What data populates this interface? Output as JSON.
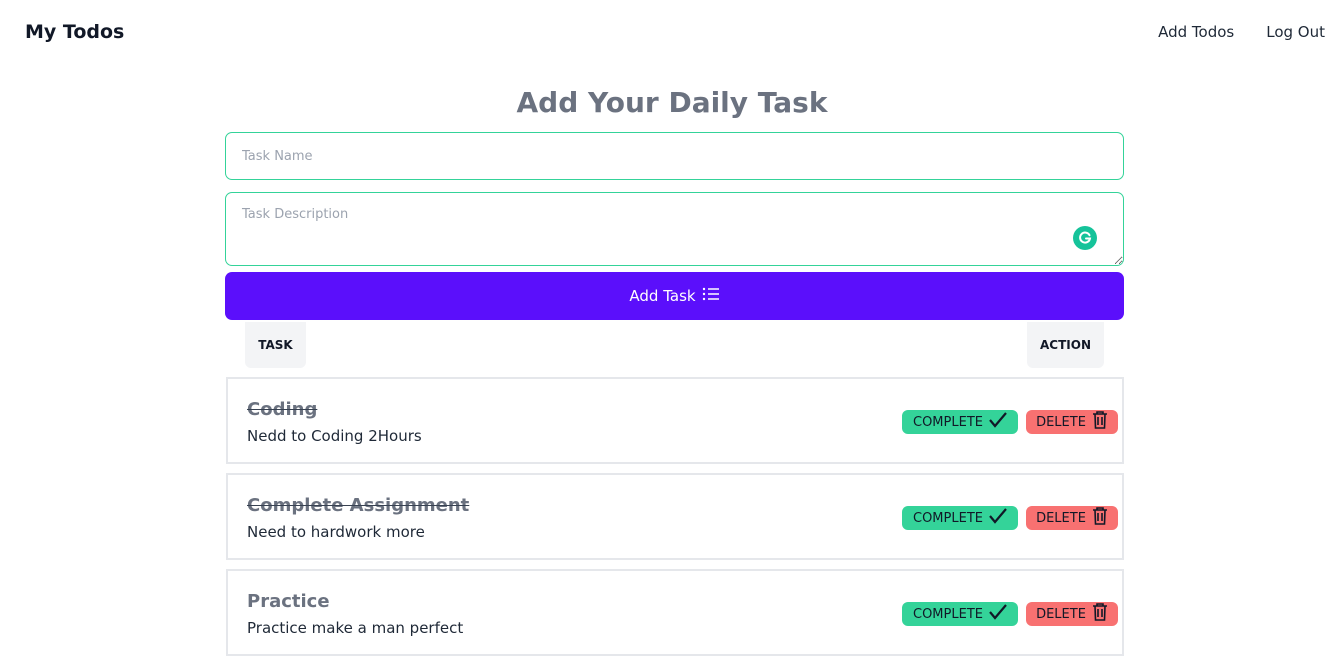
{
  "nav": {
    "brand": "My Todos",
    "links": [
      "Add Todos",
      "Log Out"
    ]
  },
  "form": {
    "title": "Add Your Daily Task",
    "task_name_placeholder": "Task Name",
    "task_description_placeholder": "Task Description",
    "add_button_label": "Add Task"
  },
  "table": {
    "headers": [
      "TASK",
      "ACTION"
    ]
  },
  "tasks": [
    {
      "title": "Coding",
      "description": "Nedd to Coding 2Hours",
      "completed": true
    },
    {
      "title": "Complete Assignment",
      "description": "Need to hardwork more",
      "completed": true
    },
    {
      "title": "Practice",
      "description": "Practice make a man perfect",
      "completed": false
    }
  ],
  "actions": {
    "complete_label": "COMPLETE",
    "delete_label": "DELETE"
  },
  "colors": {
    "accent": "#5b0ffb",
    "input_border": "#34d399",
    "complete_bg": "#34d399",
    "delete_bg": "#f87171",
    "grammarly": "#15c39a"
  }
}
